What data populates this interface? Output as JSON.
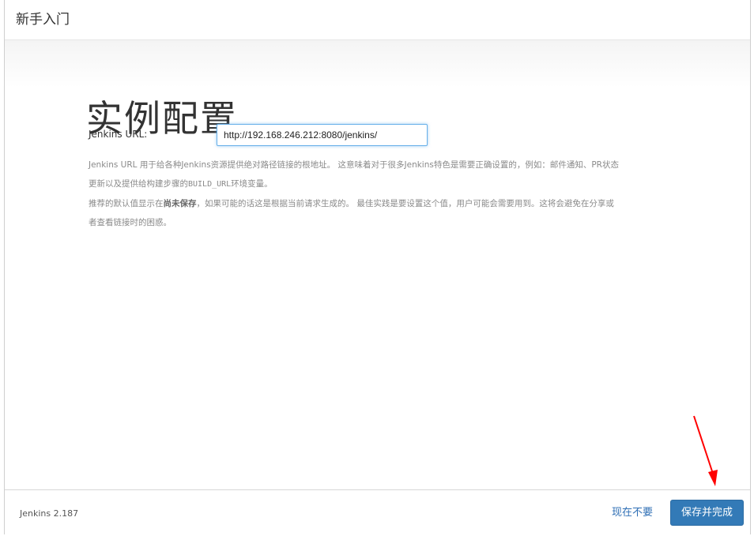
{
  "header": {
    "title": "新手入门"
  },
  "main": {
    "title": "实例配置",
    "url_label": "Jenkins URL:",
    "url_value": "http://192.168.246.212:8080/jenkins/",
    "help_line1_a": "Jenkins URL 用于给各种Jenkins资源提供绝对路径链接的根地址。 这意味着对于很多Jenkins特色是需要正确设置的，例如：邮件通知、PR状态",
    "help_line2_a": "更新以及提供给构建步骤的",
    "help_line2_code": "BUILD_URL",
    "help_line2_b": "环境变量。",
    "help_line3_a": "推荐的默认值显示在",
    "help_line3_bold": "尚未保存",
    "help_line3_b": "，如果可能的话这是根据当前请求生成的。 最佳实践是要设置这个值，用户可能会需要用到。这将会避免在分享或",
    "help_line4": "者查看链接时的困惑。"
  },
  "footer": {
    "version": "Jenkins 2.187",
    "skip_label": "现在不要",
    "save_label": "保存并完成"
  },
  "colors": {
    "primary_button": "#337ab7",
    "link": "#2f6fb5",
    "annotation_arrow": "#ff0000"
  }
}
